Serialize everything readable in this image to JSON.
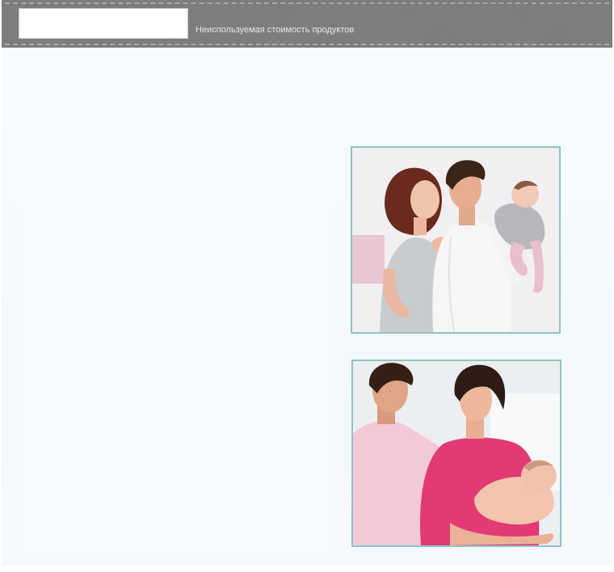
{
  "header": {
    "subtitle": "Неиспользуемая стоимость продуктов"
  },
  "colors": {
    "header_bar": "#7d7d7d",
    "photo_border": "#8fc3c5",
    "content_background": "#f5f9fc"
  },
  "images": [
    {
      "name": "family-photo-1",
      "kind": "photo"
    },
    {
      "name": "family-photo-2",
      "kind": "photo"
    }
  ]
}
